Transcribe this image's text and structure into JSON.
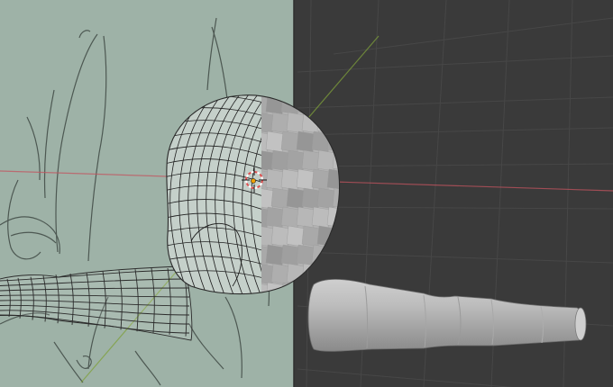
{
  "viewport": {
    "mode": "3d-viewport",
    "shading_left": "wireframe-overlay-on-reference",
    "shading_right": "solid"
  },
  "colors": {
    "reference_plane": "#9fb3a8",
    "grid_background": "#3a3a3a",
    "grid_line": "#4a4a4a",
    "x_axis": "#c2545f",
    "y_axis": "#7ea03a",
    "mesh_solid": "#b8b8b8",
    "wire": "#2b2b2b",
    "sketch": "#3f4a44",
    "cursor_red": "#e05050",
    "cursor_white": "#ffffff",
    "origin": "#f0a000"
  },
  "objects": [
    {
      "name": "head-sphere-mesh"
    },
    {
      "name": "arm-cylinder-mesh-wire"
    },
    {
      "name": "arm-cylinder-mesh-solid"
    }
  ],
  "icons": [
    "3d-cursor-icon",
    "object-origin-icon"
  ]
}
